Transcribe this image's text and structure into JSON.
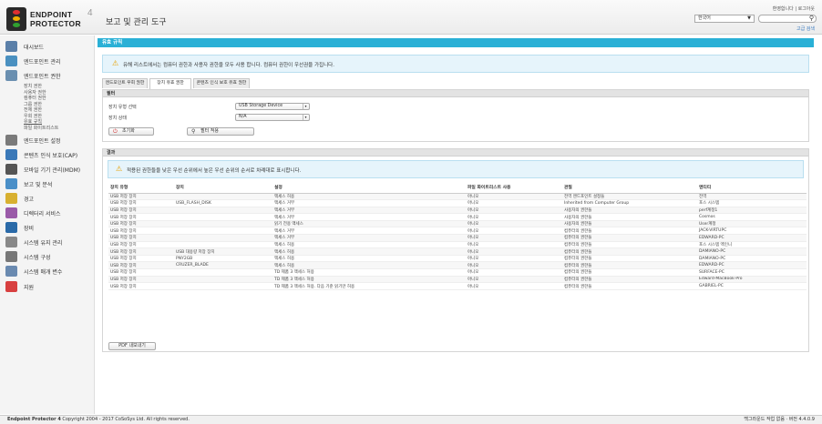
{
  "header": {
    "logo_line1": "ENDPOINT",
    "logo_line2": "PROTECTOR",
    "logo_version": "4",
    "app_title": "보고 및 관리 도구",
    "top_links": "환영합니다 | 로그아웃",
    "language": "한국어",
    "advanced_search": "고급 검색"
  },
  "sidebar": {
    "items": [
      {
        "label": "대시보드",
        "icon": "dashboard-icon",
        "color": "#5a7fa8"
      },
      {
        "label": "엔드포인트 관리",
        "icon": "monitor-icon",
        "color": "#4a90c0"
      },
      {
        "label": "엔드포인트 권한",
        "icon": "permissions-icon",
        "color": "#6a8fb0"
      },
      {
        "label": "엔드포인트 설정",
        "icon": "tools-icon",
        "color": "#7a7a7a"
      },
      {
        "label": "콘텐츠 인식 보호(CAP)",
        "icon": "cap-icon",
        "color": "#3a78b8"
      },
      {
        "label": "모바일 기기 관리(MDM)",
        "icon": "mobile-icon",
        "color": "#555555"
      },
      {
        "label": "보고 및 분석",
        "icon": "reports-icon",
        "color": "#4a8fc8"
      },
      {
        "label": "경고",
        "icon": "alert-icon",
        "color": "#d8b030"
      },
      {
        "label": "디렉터리 서비스",
        "icon": "directory-icon",
        "color": "#9a5aa8"
      },
      {
        "label": "장비",
        "icon": "appliance-icon",
        "color": "#2a6aa8"
      },
      {
        "label": "시스템 유지 관리",
        "icon": "maintenance-icon",
        "color": "#888888"
      },
      {
        "label": "시스템 구성",
        "icon": "config-icon",
        "color": "#777777"
      },
      {
        "label": "시스템 매개 변수",
        "icon": "parameters-icon",
        "color": "#6a8ab0"
      },
      {
        "label": "지원",
        "icon": "support-icon",
        "color": "#d84040"
      }
    ],
    "sub_items": [
      "장치 권한",
      "사용자 권한",
      "컴퓨터 권한",
      "그룹 권한",
      "전체 권한",
      "우회 권한",
      "유효 규칙",
      "파일 화이트리스트"
    ]
  },
  "main": {
    "page_title": "유효 규칙",
    "info_text": "유해 리스트에서는 컴퓨터 권한과 사용자 권한을 모두 사용 합니다. 컴퓨터 권한이 우선권을 가집니다.",
    "tabs": [
      "엔드포인트 우회 권한",
      "장치 유효 권한",
      "콘텐츠 인식 보호 유효 권한"
    ],
    "filter": {
      "title": "필터",
      "device_type_label": "장치 유형 선택",
      "device_type_value": "USB Storage Device",
      "device_status_label": "장치 상태",
      "device_status_value": "N/A",
      "reset_button": "초기화",
      "apply_button": "필터 적용"
    },
    "results": {
      "title": "결과",
      "notice": "적용된 권한들을 낮은 우선 순위에서 높은 우선 순위의 순서로 차례대로 표시합니다.",
      "columns": [
        "장치 유형",
        "장치",
        "설정",
        "파일 화이트리스트 사용",
        "관질",
        "엔티티"
      ],
      "rows": [
        [
          "USB 저장 장치",
          "",
          "액세스 허용",
          "아니오",
          "전역 엔드포인트 설정들",
          "전역"
        ],
        [
          "USB 저장 장치",
          "USB_FLASH_DISK",
          "액세스 거부",
          "아니오",
          "Inherited from Computer Group",
          "포스 시스템"
        ],
        [
          "USB 저장 장치",
          "",
          "액세스 거부",
          "아니오",
          "사용자의 권한들",
          "perf계정1"
        ],
        [
          "USB 저장 장치",
          "",
          "액세스 거부",
          "아니오",
          "사용자의 권한들",
          "Cosmos"
        ],
        [
          "USB 저장 장치",
          "",
          "읽기 전용 액세스",
          "아니오",
          "사용자의 권한들",
          "User계정"
        ],
        [
          "USB 저장 장치",
          "",
          "액세스 거부",
          "아니오",
          "컴퓨터의 권한들",
          "JACK-VIRTUPC"
        ],
        [
          "USB 저장 장치",
          "",
          "액세스 거부",
          "아니오",
          "컴퓨터의 권한들",
          "EDWARD-PC"
        ],
        [
          "USB 저장 장치",
          "",
          "액세스 허용",
          "아니오",
          "컴퓨터의 권한들",
          "포스 시스템 엑인니"
        ],
        [
          "USB 저장 장치",
          "USB 대용량 저장 장치",
          "액세스 허용",
          "아니오",
          "컴퓨터의 권한들",
          "DAMIANO-PC"
        ],
        [
          "USB 저장 장치",
          "PNY2GB",
          "액세스 허용",
          "아니오",
          "컴퓨터의 권한들",
          "DAMIANO-PC"
        ],
        [
          "USB 저장 장치",
          "CRUZER_BLADE",
          "액세스 허용",
          "아니오",
          "컴퓨터의 권한들",
          "EDWARD-PC"
        ],
        [
          "USB 저장 장치",
          "",
          "TD 제품 3 액세스 허용",
          "아니오",
          "컴퓨터의 권한들",
          "SURFACE-PC"
        ],
        [
          "USB 저장 장치",
          "",
          "TD 제품 3 액세스 허용",
          "아니오",
          "컴퓨터의 권한들",
          "Edward-MacBook-Pro"
        ],
        [
          "USB 저장 장치",
          "",
          "TD 제품 3 액세스 허용. 다음 기준 읽기만 허용",
          "아니오",
          "컴퓨터의 권한들",
          "GABRIEL-PC"
        ]
      ],
      "export_button": "PDF 내보내기"
    }
  },
  "footer": {
    "left_bold": "Endpoint Protector 4",
    "left_text": " Copyright 2004 - 2017 CoSoSys Ltd. All rights reserved.",
    "right": "백그라운드 작업 없음 · 버전 4.4.0.9"
  }
}
